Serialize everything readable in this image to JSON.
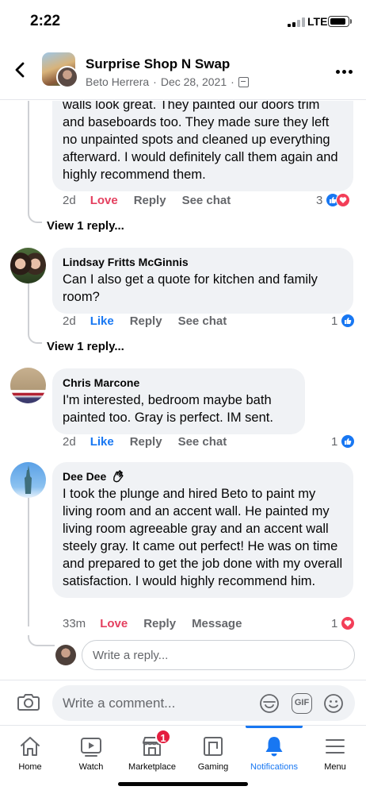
{
  "status_bar": {
    "time": "2:22",
    "network": "LTE"
  },
  "header": {
    "title": "Surprise Shop N Swap",
    "author": "Beto Herrera",
    "separator": "·",
    "date": "Dec 28, 2021",
    "icons": {
      "back": "chevron-left-icon",
      "privacy": "group-icon",
      "more": "more-options-icon"
    }
  },
  "comments": [
    {
      "text": "walls look great. They painted our doors trim and baseboards too. They made sure they left no unpainted spots and cleaned up everything afterward. I would definitely call them again and highly recommend them.",
      "time": "2d",
      "reaction_label": "Love",
      "reply_label": "Reply",
      "chat_label": "See chat",
      "reaction_count": "3",
      "reactions": [
        "like",
        "love"
      ],
      "view_replies": "View 1 reply..."
    },
    {
      "author": "Lindsay Fritts McGinnis",
      "text": "Can I also get a quote for kitchen and family room?",
      "time": "2d",
      "reaction_label": "Like",
      "reply_label": "Reply",
      "chat_label": "See chat",
      "reaction_count": "1",
      "reactions": [
        "like"
      ],
      "view_replies": "View 1 reply..."
    },
    {
      "author": "Chris Marcone",
      "text": "I'm interested, bedroom maybe bath painted too. Gray is perfect. IM sent.",
      "time": "2d",
      "reaction_label": "Like",
      "reply_label": "Reply",
      "chat_label": "See chat",
      "reaction_count": "1",
      "reactions": [
        "like"
      ]
    },
    {
      "author": "Dee Dee",
      "author_badge": "waving-hand-icon",
      "text": "I took the plunge and hired Beto to paint my living room and an accent wall. He painted my living room agreeable gray and an accent wall steely gray. It came out perfect! He was on time and prepared to get the job done with my overall satisfaction. I would highly recommend him.",
      "time": "33m",
      "reaction_label": "Love",
      "reply_label": "Reply",
      "chat_label": "Message",
      "reaction_count": "1",
      "reactions": [
        "love"
      ]
    }
  ],
  "reply_box": {
    "placeholder": "Write a reply..."
  },
  "composer": {
    "placeholder": "Write a comment...",
    "icons": [
      "camera-icon",
      "sticker-icon",
      "gif-icon",
      "emoji-icon"
    ],
    "gif_label": "GIF"
  },
  "tabs": [
    {
      "label": "Home",
      "icon": "home-icon"
    },
    {
      "label": "Watch",
      "icon": "watch-icon"
    },
    {
      "label": "Marketplace",
      "icon": "marketplace-icon",
      "badge": "1"
    },
    {
      "label": "Gaming",
      "icon": "gaming-icon"
    },
    {
      "label": "Notifications",
      "icon": "bell-icon",
      "active": true
    },
    {
      "label": "Menu",
      "icon": "menu-icon"
    }
  ],
  "colors": {
    "accent": "#1877f2",
    "love": "#e4405f",
    "badge": "#e41e3f",
    "bubble": "#f0f2f5",
    "muted": "#65676b"
  }
}
